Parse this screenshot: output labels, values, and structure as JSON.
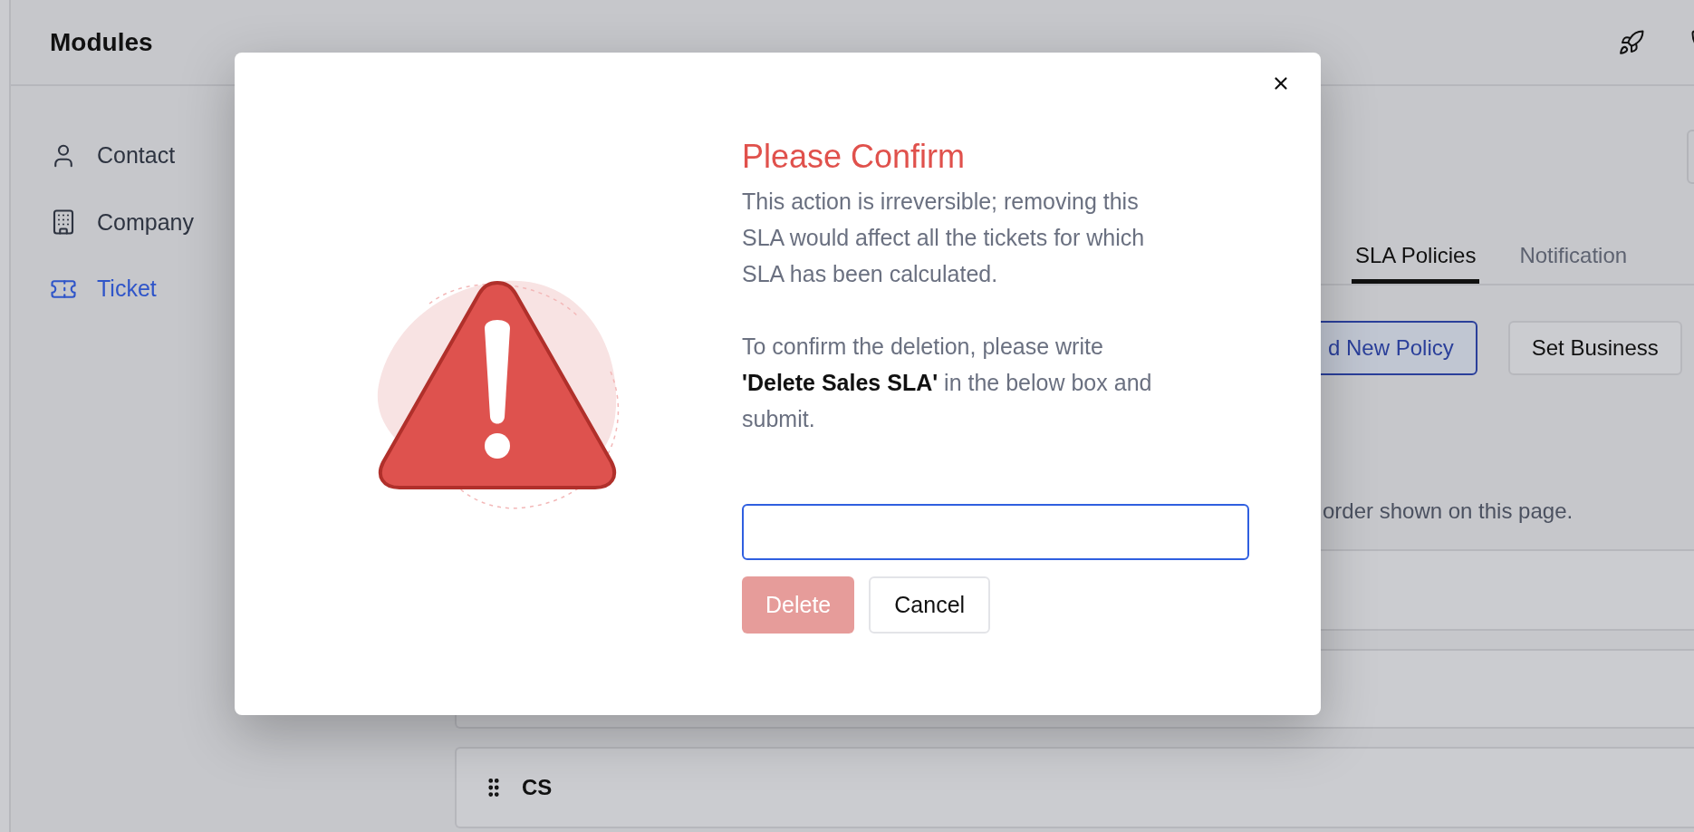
{
  "header": {
    "title": "Modules"
  },
  "sidebar": {
    "items": [
      {
        "label": "Contact",
        "selected": false
      },
      {
        "label": "Company",
        "selected": false
      },
      {
        "label": "Ticket",
        "selected": true
      }
    ]
  },
  "tabs": [
    {
      "label": "SLA Policies",
      "selected": true
    },
    {
      "label": "Notification",
      "selected": false
    }
  ],
  "actions": [
    {
      "label": "d New Policy",
      "kind": "primary"
    },
    {
      "label": "Set Business",
      "kind": "secondary"
    }
  ],
  "hint": "order shown on this page.",
  "rows": [
    {
      "label": "CS"
    }
  ],
  "modal": {
    "title": "Please Confirm",
    "paragraphs": [
      "This action is irreversible; removing this SLA would affect all the tickets for which SLA has been calculated.",
      "To confirm the deletion, please write **'Delete Sales SLA'** in the below box and submit."
    ],
    "buttons": [
      {
        "label": "Delete",
        "kind": "danger",
        "disabled": true
      },
      {
        "label": "Cancel",
        "kind": "secondary",
        "disabled": false
      }
    ]
  }
}
